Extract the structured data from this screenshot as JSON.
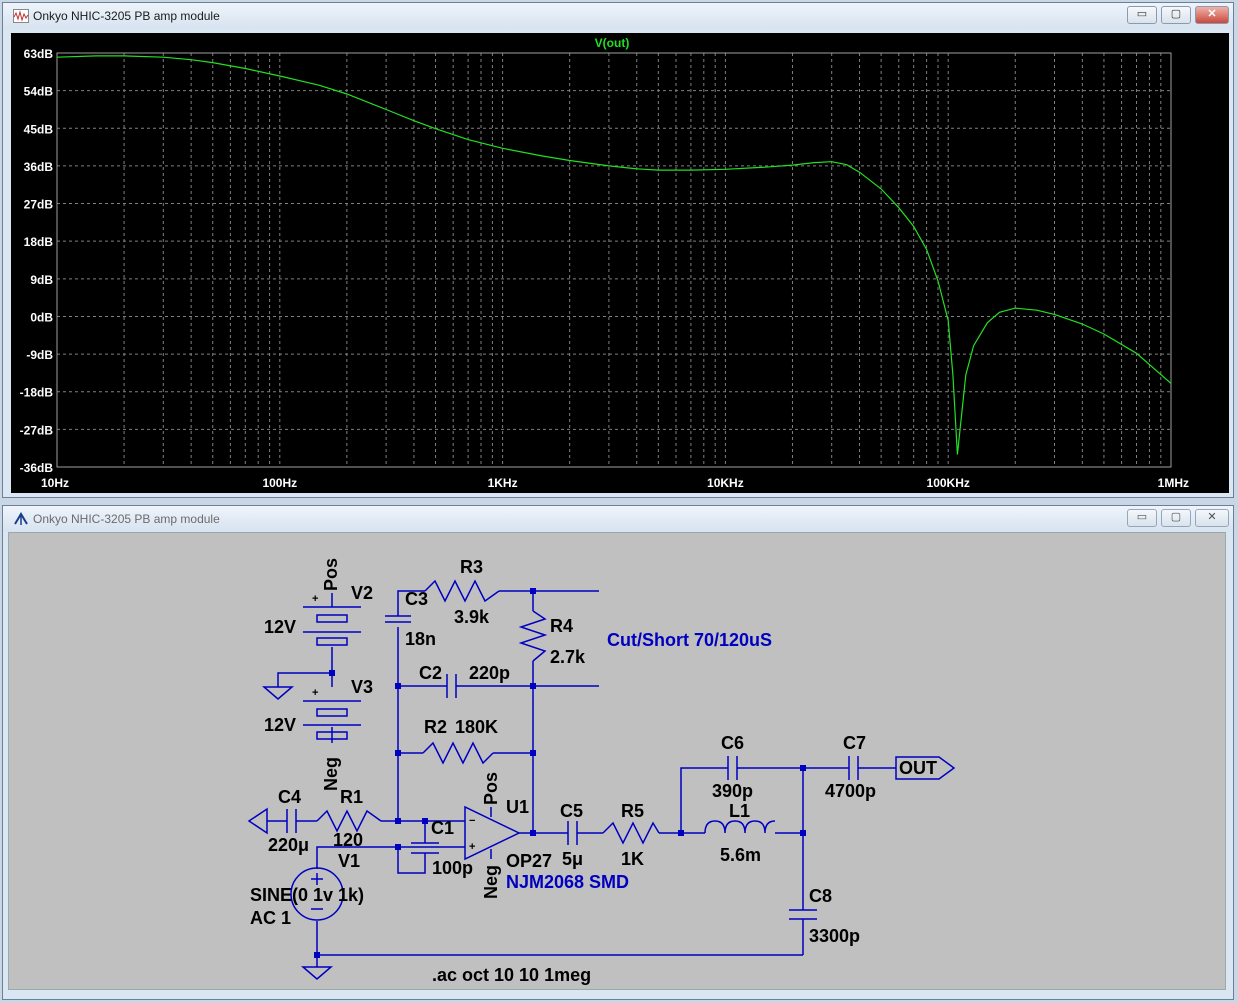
{
  "plot_window": {
    "title": "Onkyo NHIC-3205 PB amp module",
    "controls": {
      "minimize": "▭",
      "maximize": "▢",
      "close": "✕"
    }
  },
  "schematic_window": {
    "title": "Onkyo NHIC-3205 PB amp module",
    "controls": {
      "minimize": "▭",
      "maximize": "▢",
      "close": "✕"
    }
  },
  "chart_data": {
    "type": "line",
    "title": "V(out)",
    "xlabel": "",
    "ylabel": "",
    "x_scale": "log",
    "xlim": [
      10,
      1000000
    ],
    "ylim": [
      -36,
      63
    ],
    "x_tick_labels": [
      "10Hz",
      "100Hz",
      "1KHz",
      "10KHz",
      "100KHz",
      "1MHz"
    ],
    "y_tick_labels": [
      "63dB",
      "54dB",
      "45dB",
      "36dB",
      "27dB",
      "18dB",
      "9dB",
      "0dB",
      "-9dB",
      "-18dB",
      "-27dB",
      "-36dB"
    ],
    "grid": true,
    "colors": {
      "background": "#000000",
      "trace": "#22e022",
      "grid": "#808080",
      "text": "#ffffff"
    },
    "series": [
      {
        "name": "V(out)",
        "x": [
          10,
          15,
          20,
          30,
          40,
          50,
          70,
          100,
          150,
          200,
          300,
          400,
          500,
          700,
          1000,
          1500,
          2000,
          3000,
          4000,
          5000,
          7000,
          10000,
          15000,
          20000,
          25000,
          30000,
          35000,
          40000,
          50000,
          60000,
          70000,
          80000,
          90000,
          100000,
          105000,
          110000,
          120000,
          130000,
          150000,
          170000,
          200000,
          250000,
          300000,
          400000,
          500000,
          700000,
          1000000
        ],
        "y": [
          62.0,
          62.3,
          62.3,
          62.0,
          61.4,
          60.7,
          59.3,
          57.5,
          55.3,
          53.2,
          49.5,
          46.8,
          44.9,
          42.3,
          40.2,
          38.4,
          37.3,
          36.0,
          35.3,
          35.0,
          35.0,
          35.2,
          35.7,
          36.2,
          36.8,
          37.0,
          36.3,
          34.5,
          30.5,
          26.0,
          21.5,
          16.0,
          8.5,
          -1.0,
          -14.0,
          -33.0,
          -14.0,
          -7.0,
          -1.5,
          1.0,
          2.0,
          1.5,
          0.5,
          -1.8,
          -4.2,
          -8.8,
          -16.0
        ]
      }
    ]
  },
  "schematic": {
    "parts": {
      "V2": {
        "ref": "V2",
        "value": "12V",
        "pin": "Pos"
      },
      "V3": {
        "ref": "V3",
        "value": "12V",
        "pin": "Neg"
      },
      "R3": {
        "ref": "R3",
        "value": "3.9k"
      },
      "C3": {
        "ref": "C3",
        "value": "18n"
      },
      "R4": {
        "ref": "R4",
        "value": "2.7k"
      },
      "C2": {
        "ref": "C2",
        "value": "220p"
      },
      "R2": {
        "ref": "R2",
        "value": "180K"
      },
      "C4": {
        "ref": "C4",
        "value": "220μ"
      },
      "R1": {
        "ref": "R1",
        "value": "120"
      },
      "C1": {
        "ref": "C1",
        "value": "100p"
      },
      "U1": {
        "ref": "U1",
        "value": "OP27",
        "pos": "Pos",
        "neg": "Neg"
      },
      "C5": {
        "ref": "C5",
        "value": "5μ"
      },
      "R5": {
        "ref": "R5",
        "value": "1K"
      },
      "C6": {
        "ref": "C6",
        "value": "390p"
      },
      "L1": {
        "ref": "L1",
        "value": "5.6m"
      },
      "C7": {
        "ref": "C7",
        "value": "4700p"
      },
      "C8": {
        "ref": "C8",
        "value": "3300p"
      },
      "V1": {
        "ref": "V1",
        "value1": "SINE(0 1v 1k)",
        "value2": "AC 1"
      }
    },
    "out_label": "OUT",
    "note_cut": "Cut/Short 70/120uS",
    "note_chip": "NJM2068 SMD",
    "directive": ".ac oct 10 10 1meg",
    "colors": {
      "wire": "#0000c0",
      "text": "#000000",
      "note": "#0000c0",
      "bg": "#c0c0c0"
    }
  }
}
